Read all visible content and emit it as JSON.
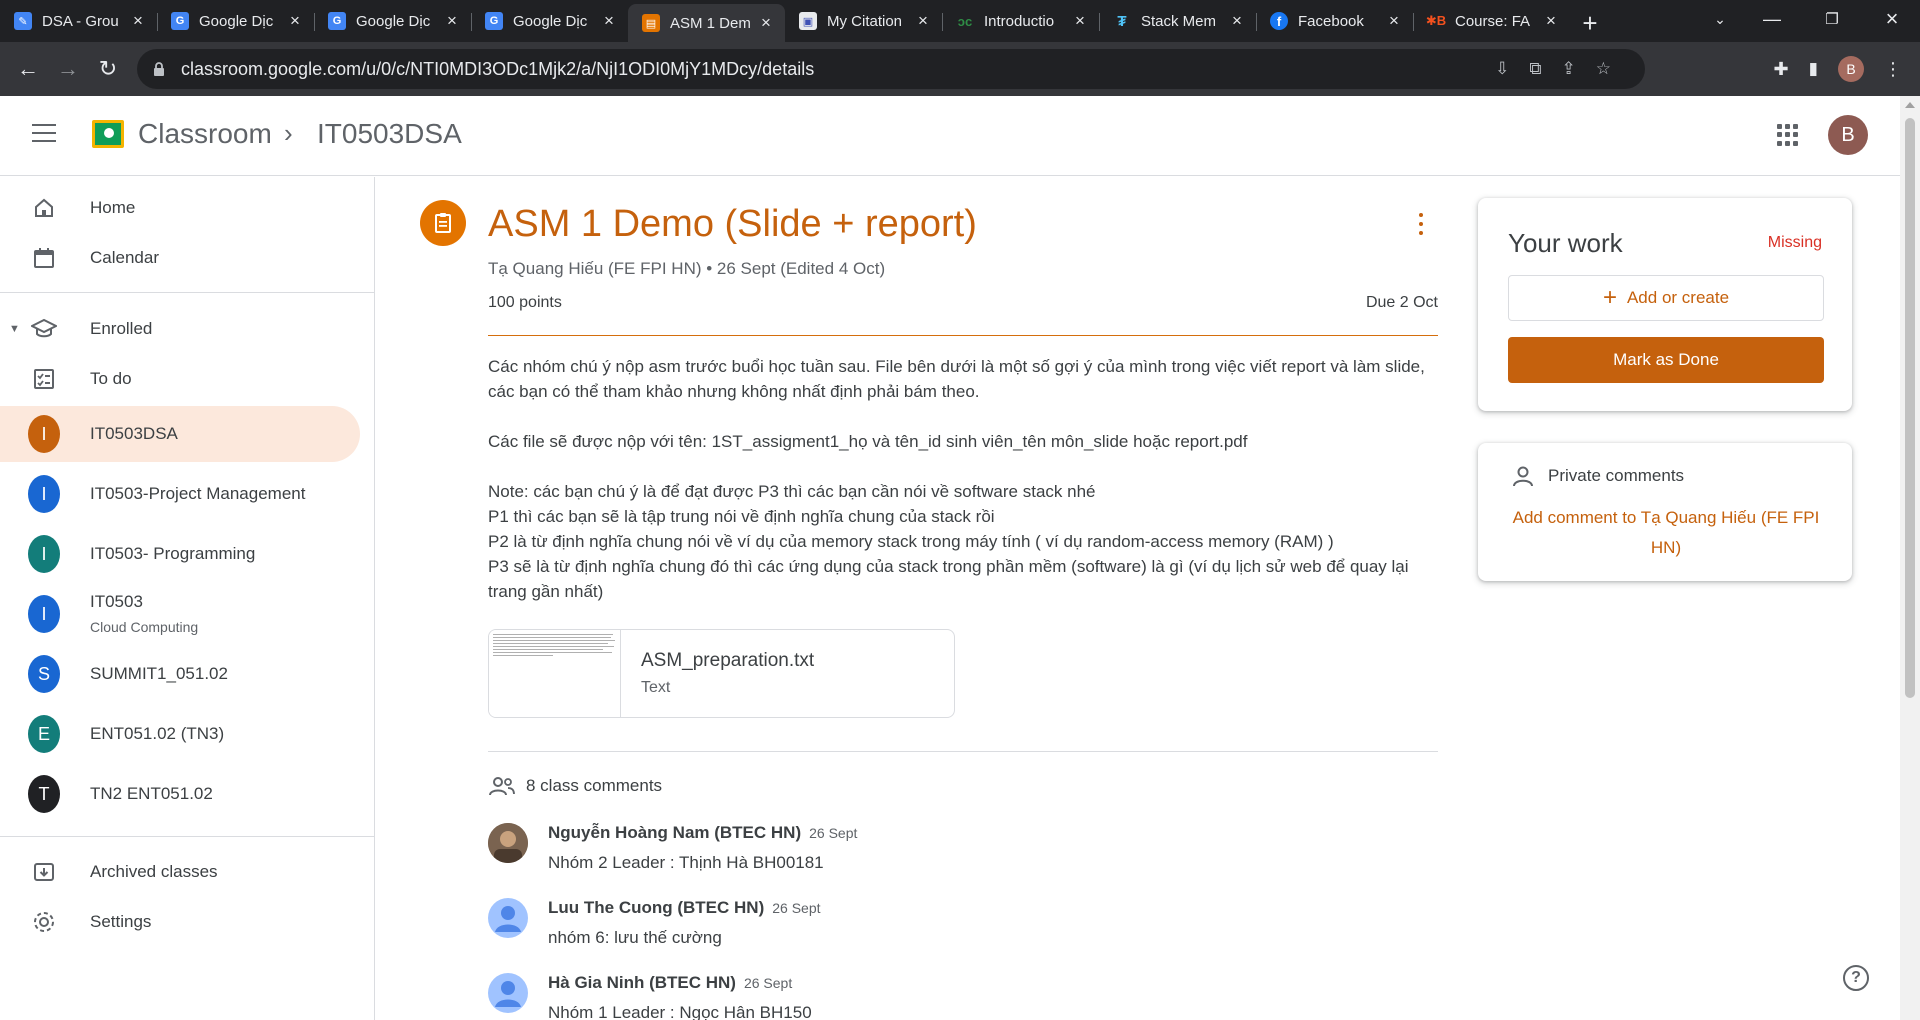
{
  "browser": {
    "tabs": [
      {
        "title": "DSA - Grou",
        "favicon": "classroom-icon",
        "color": "#4285f4"
      },
      {
        "title": "Google Dịc",
        "favicon": "translate-icon",
        "color": "#4285f4"
      },
      {
        "title": "Google Dịc",
        "favicon": "translate-icon",
        "color": "#4285f4"
      },
      {
        "title": "Google Dịc",
        "favicon": "translate-icon",
        "color": "#4285f4"
      },
      {
        "title": "ASM 1 Dem",
        "favicon": "assignment-icon",
        "color": "#e37400",
        "active": true
      },
      {
        "title": "My Citation",
        "favicon": "citation-icon",
        "color": "#3f51b5"
      },
      {
        "title": "Introductio",
        "favicon": "geeksforgeeks-icon",
        "color": "#2f8d46"
      },
      {
        "title": "Stack Mem",
        "favicon": "stack-icon",
        "color": "#1a73e8"
      },
      {
        "title": "Facebook",
        "favicon": "facebook-icon",
        "color": "#1877f2"
      },
      {
        "title": "Course: FA",
        "favicon": "course-icon",
        "color": "#e65100"
      }
    ],
    "url": "classroom.google.com/u/0/c/NTI0MDI3ODc1Mjk2/a/NjI1ODI0MjY1MDcy/details",
    "profile_initial": "B"
  },
  "header": {
    "brand": "Classroom",
    "separator": "›",
    "class_name": "IT0503DSA",
    "account_initial": "B"
  },
  "sidebar": {
    "home": "Home",
    "calendar": "Calendar",
    "enrolled": "Enrolled",
    "todo": "To do",
    "classes": [
      {
        "initial": "I",
        "name": "IT0503DSA",
        "subtitle": "",
        "color": "#c5610d",
        "selected": true
      },
      {
        "initial": "I",
        "name": "IT0503-Project Management",
        "subtitle": "",
        "color": "#1967d2"
      },
      {
        "initial": "I",
        "name": "IT0503- Programming",
        "subtitle": "",
        "color": "#137d7a"
      },
      {
        "initial": "I",
        "name": "IT0503",
        "subtitle": "Cloud Computing",
        "color": "#1967d2"
      },
      {
        "initial": "S",
        "name": "SUMMIT1_051.02",
        "subtitle": "",
        "color": "#1967d2"
      },
      {
        "initial": "E",
        "name": "ENT051.02 (TN3)",
        "subtitle": "",
        "color": "#137d7a"
      },
      {
        "initial": "T",
        "name": "TN2 ENT051.02",
        "subtitle": "",
        "color": "#202124"
      }
    ],
    "archived": "Archived classes",
    "settings": "Settings"
  },
  "assignment": {
    "title": "ASM 1 Demo (Slide + report)",
    "meta": "Tạ Quang Hiếu (FE FPI HN) • 26 Sept (Edited 4 Oct)",
    "points": "100 points",
    "due": "Due 2 Oct",
    "paragraphs": [
      "Các nhóm chú ý nộp asm trước buổi học tuần sau. File bên dưới là một số gợi ý của mình trong việc viết report và làm slide, các bạn có thể tham khảo nhưng không nhất định phải bám theo.",
      "Các file sẽ được nộp với tên: 1ST_assigment1_họ và tên_id sinh viên_tên môn_slide hoặc report.pdf",
      "Note: các bạn chú ý là để đạt được P3 thì các bạn cần nói về software stack nhé",
      "P1 thì các bạn sẽ là tập trung nói về định nghĩa chung của stack rồi",
      "P2 là từ định nghĩa chung nói về ví dụ của memory stack trong máy tính ( ví dụ random-access memory (RAM) )",
      "P3 sẽ là từ định nghĩa chung đó thì các ứng dụng của stack trong phần mềm (software) là gì (ví dụ lịch sử web để quay lại trang gần nhất)"
    ],
    "attachment": {
      "name": "ASM_preparation.txt",
      "type": "Text"
    }
  },
  "comments": {
    "header": "8 class comments",
    "items": [
      {
        "author": "Nguyễn Hoàng Nam (BTEC HN)",
        "date": "26 Sept",
        "text": "Nhóm 2 Leader : Thịnh Hà BH00181",
        "avatar": "photo"
      },
      {
        "author": "Luu The Cuong (BTEC HN)",
        "date": "26 Sept",
        "text": "nhóm 6: lưu thế cường",
        "avatar": "default"
      },
      {
        "author": "Hà Gia Ninh (BTEC HN)",
        "date": "26 Sept",
        "text": "Nhóm 1 Leader : Ngọc Hân BH150",
        "avatar": "default"
      }
    ]
  },
  "your_work": {
    "title": "Your work",
    "status": "Missing",
    "add_label": "Add or create",
    "done_label": "Mark as Done"
  },
  "private_comments": {
    "title": "Private comments",
    "add_label": "Add comment to Tạ Quang Hiếu (FE FPI HN)"
  },
  "colors": {
    "accent": "#c5610d",
    "missing": "#d93025"
  }
}
